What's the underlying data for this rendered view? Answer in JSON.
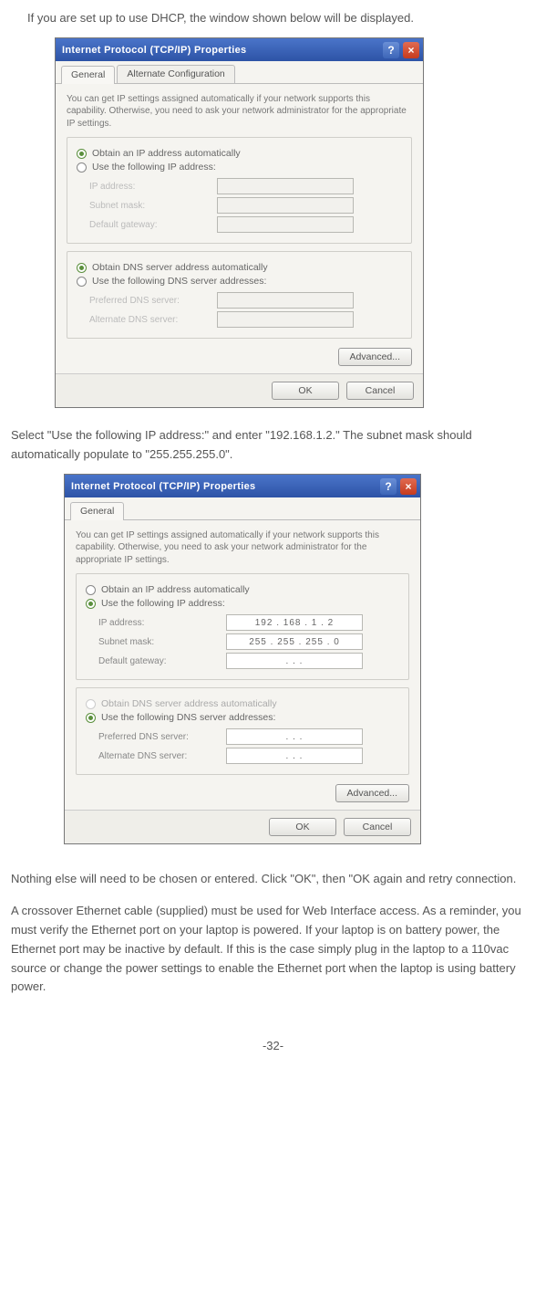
{
  "intro": "If you are set up to use DHCP, the window shown below will be displayed.",
  "mid": "Select \"Use the following IP address:\" and enter \"192.168.1.2.\"  The subnet mask should automatically populate to \"255.255.255.0\".",
  "outro1": "Nothing else will need  to be chosen or entered. Click \"OK\", then \"OK again and retry connection.",
  "outro2": "A crossover Ethernet cable (supplied) must be used for Web Interface access. As a reminder, you must verify the Ethernet port on your laptop is powered. If your laptop is on battery power, the Ethernet port may be inactive by default.  If this is the case simply plug in the laptop to a 110vac source or change the power settings to enable the Ethernet port when the laptop is using battery power.",
  "pagenum": "-32-",
  "dialog": {
    "title": "Internet Protocol (TCP/IP) Properties",
    "tabs": {
      "general": "General",
      "alt": "Alternate Configuration"
    },
    "desc": "You can get IP settings assigned automatically if your network supports this capability. Otherwise, you need to ask your network administrator for the appropriate IP settings.",
    "radios": {
      "obtain_ip": "Obtain an IP address automatically",
      "use_ip": "Use the following IP address:",
      "obtain_dns": "Obtain DNS server address automatically",
      "use_dns": "Use the following DNS server addresses:"
    },
    "labels": {
      "ip": "IP address:",
      "subnet": "Subnet mask:",
      "gateway": "Default gateway:",
      "pref_dns": "Preferred DNS server:",
      "alt_dns": "Alternate DNS server:"
    },
    "buttons": {
      "advanced": "Advanced...",
      "ok": "OK",
      "cancel": "Cancel"
    }
  },
  "dialog2": {
    "ip": "192 . 168 .  1  .  2",
    "subnet": "255 . 255 . 255 .  0",
    "gateway": ".        .        .",
    "dns_dots": ".        .        ."
  }
}
